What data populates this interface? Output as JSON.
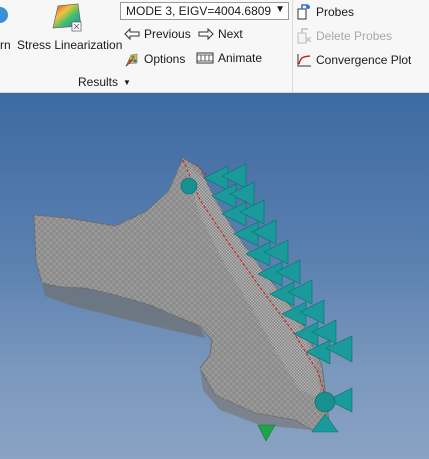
{
  "ribbon": {
    "stress_partial_label": "rn",
    "stress_linearization_label": "Stress Linearization",
    "mode_select_value": "MODE 3, EIGV=4004.6809",
    "previous_label": "Previous",
    "next_label": "Next",
    "options_label": "Options",
    "animate_label": "Animate",
    "probes_label": "Probes",
    "delete_probes_label": "Delete Probes",
    "convergence_plot_label": "Convergence Plot",
    "results_group_label": "Results"
  },
  "colors": {
    "viewport_top": "#3d6aa2",
    "viewport_bottom": "#8aa3c4",
    "mesh": "#8c8c8c",
    "constraint": "#1a9a9a",
    "load_arrow": "#1fa34a",
    "edge": "#d01818"
  }
}
